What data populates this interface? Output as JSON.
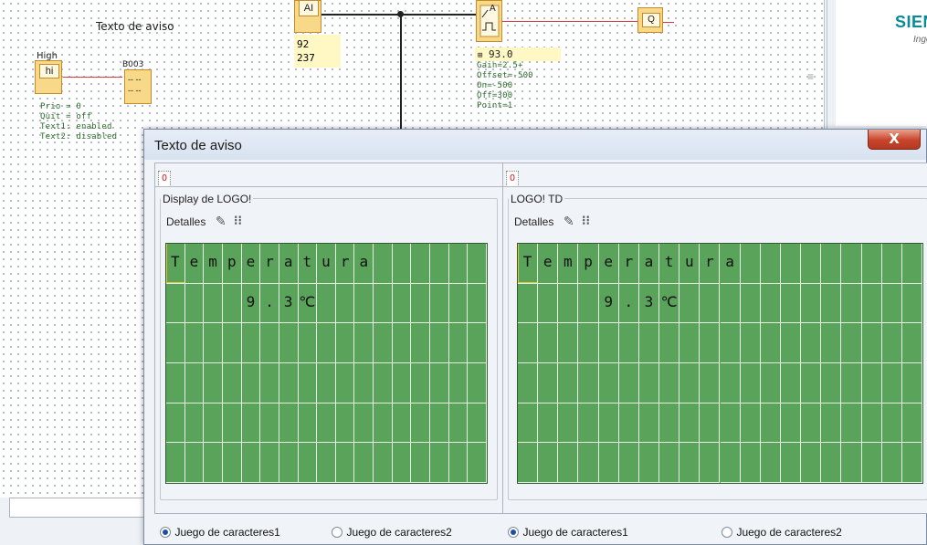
{
  "diagram": {
    "texto_aviso_label": "Texto de aviso",
    "high_label": "High",
    "hi_block": "hi",
    "b003_label": "B003",
    "b003_lines": [
      "-- --",
      "-- --"
    ],
    "params": [
      "Prio = 0",
      "Quit = off",
      "Text1: enabled",
      "Text2: disabled"
    ],
    "ai_block": "AI",
    "ai_values": [
      "92",
      "237"
    ],
    "amp_block": "A",
    "amp_value": "93.0",
    "amp_params": [
      "Gain=2.5+",
      "Offset=-500",
      "On=-500",
      "Off=300",
      "Point=1"
    ],
    "q_block": "Q"
  },
  "side": {
    "brand": "SIEM",
    "brand_sub": "Inge"
  },
  "dialog": {
    "title": "Texto de aviso",
    "close_label": "X",
    "left": {
      "tab": "0",
      "group_label": "Display de LOGO!",
      "detalles_label": "Detalles",
      "rows": [
        [
          "T",
          "e",
          "m",
          "p",
          "e",
          "r",
          "a",
          "t",
          "u",
          "r",
          "a",
          "",
          "",
          "",
          "",
          "",
          ""
        ],
        [
          "",
          "",
          "",
          "",
          "9",
          ".",
          "3",
          "℃",
          "",
          "",
          "",
          "",
          "",
          "",
          "",
          "",
          ""
        ],
        [
          "",
          "",
          "",
          "",
          "",
          "",
          "",
          "",
          "",
          "",
          "",
          "",
          "",
          "",
          "",
          "",
          ""
        ],
        [
          "",
          "",
          "",
          "",
          "",
          "",
          "",
          "",
          "",
          "",
          "",
          "",
          "",
          "",
          "",
          "",
          ""
        ],
        [
          "",
          "",
          "",
          "",
          "",
          "",
          "",
          "",
          "",
          "",
          "",
          "",
          "",
          "",
          "",
          "",
          ""
        ],
        [
          "",
          "",
          "",
          "",
          "",
          "",
          "",
          "",
          "",
          "",
          "",
          "",
          "",
          "",
          "",
          "",
          ""
        ]
      ],
      "radio1": "Juego de caracteres1",
      "radio2": "Juego de caracteres2",
      "selected": 1
    },
    "right": {
      "tab": "0",
      "group_label": "LOGO! TD",
      "detalles_label": "Detalles",
      "rows": [
        [
          "T",
          "e",
          "m",
          "p",
          "e",
          "r",
          "a",
          "t",
          "u",
          "r",
          "a",
          "",
          "",
          "",
          "",
          "",
          "",
          "",
          "",
          ""
        ],
        [
          "",
          "",
          "",
          "",
          "9",
          ".",
          "3",
          "℃",
          "",
          "",
          "",
          "",
          "",
          "",
          "",
          "",
          "",
          "",
          "",
          ""
        ],
        [
          "",
          "",
          "",
          "",
          "",
          "",
          "",
          "",
          "",
          "",
          "",
          "",
          "",
          "",
          "",
          "",
          "",
          "",
          "",
          ""
        ],
        [
          "",
          "",
          "",
          "",
          "",
          "",
          "",
          "",
          "",
          "",
          "",
          "",
          "",
          "",
          "",
          "",
          "",
          "",
          "",
          ""
        ],
        [
          "",
          "",
          "",
          "",
          "",
          "",
          "",
          "",
          "",
          "",
          "",
          "",
          "",
          "",
          "",
          "",
          "",
          "",
          "",
          ""
        ],
        [
          "",
          "",
          "",
          "",
          "",
          "",
          "",
          "",
          "",
          "",
          "",
          "",
          "",
          "",
          "",
          "",
          "",
          "",
          "",
          ""
        ]
      ],
      "radio1": "Juego de caracteres1",
      "radio2": "Juego de caracteres2",
      "selected": 1
    }
  }
}
